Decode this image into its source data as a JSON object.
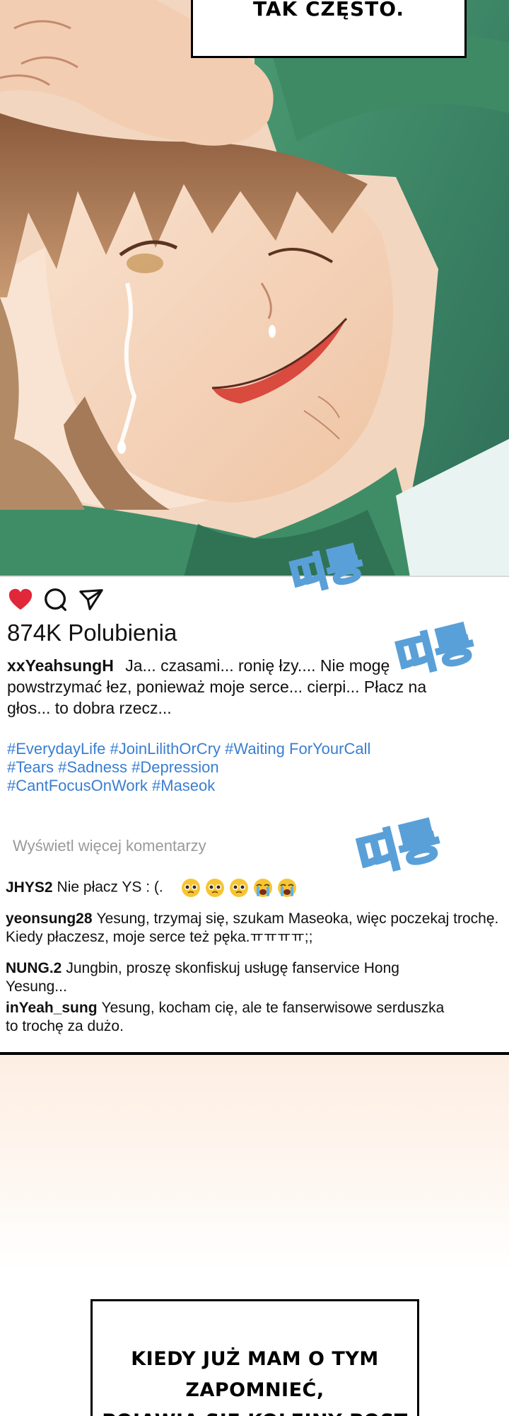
{
  "panel_top": {
    "caption": "TAK CZĘSTO."
  },
  "post": {
    "likes": "874K Polubienia",
    "username": "xxYeahsungH",
    "caption": "Ja... czasami... ronię łzy.... Nie mogę powstrzymać łez, ponieważ moje serce... cierpi... Płacz na głos... to dobra rzecz...",
    "hashtags_line1": "#EverydayLife #JoinLilithOrCry #Waiting ForYourCall",
    "hashtags_line2": "#Tears #Sadness #Depression",
    "hashtags_line3": "#CantFocusOnWork #Maseok",
    "view_more": "Wyświetl więcej komentarzy",
    "comments": [
      {
        "user": "JHYS2",
        "text": "Nie płacz YS : (."
      },
      {
        "user": "yeonsung28",
        "text": "Yesung, trzymaj się, szukam Maseoka, więc poczekaj trochę. Kiedy płaczesz, moje serce też pęka.ㅠㅠㅠㅠ;;"
      },
      {
        "user": "NUNG.2",
        "text": "Jungbin, proszę skonfiskuj usługę fanservice Hong Yesung..."
      },
      {
        "user": "inYeah_sung",
        "text": "Yesung, kocham cię, ale te fanserwisowe serduszka to trochę za dużo."
      }
    ],
    "icons": [
      "heart-icon",
      "comment-icon",
      "share-icon"
    ],
    "like_color": "#e0283a",
    "hashtag_color": "#3a7ed1"
  },
  "sfx": [
    "띠롱",
    "띠롱",
    "띠롱"
  ],
  "panel_bottom": {
    "caption_line1": "KIEDY JUŻ MAM O TYM ZAPOMNIEĆ,",
    "caption_line2": "POJAWIA SIĘ KOLEJNY POST"
  }
}
